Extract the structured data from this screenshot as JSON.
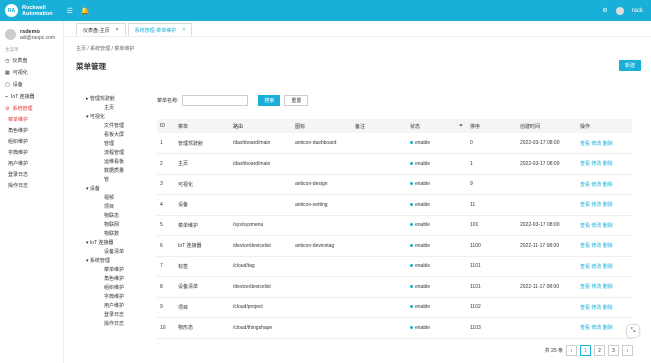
{
  "header": {
    "logo": "RA",
    "brand_line1": "Rockwell",
    "brand_line2": "Automation",
    "user": "rack"
  },
  "sidebar": {
    "name": "rsdemo",
    "email": "adi@raopc.com",
    "section": "主菜单",
    "items": [
      "仪表盘",
      "可视化",
      "设备",
      "IoT 连接器",
      "系统管理"
    ],
    "subitems": [
      "菜单维护",
      "角色维护",
      "组织维护",
      "字典维护",
      "用户维护",
      "登录日志",
      "操作日志"
    ]
  },
  "tabs": [
    "仪表盘-主页",
    "系统管理-菜单维护"
  ],
  "breadcrumb": "主页  /  系统管理  /  菜单维护",
  "title": "菜单管理",
  "new_label": "新建",
  "tree": [
    "管理驾驶舱",
    "主页",
    "可视化",
    "文件管理",
    "看板大屏",
    "管理",
    "流程管理",
    "运维看板",
    "数据质量",
    "管",
    "设备",
    "视频",
    "项目",
    "物联态",
    "物联网",
    "物联数",
    "IoT 连接器",
    "设备清单",
    "系统管理",
    "菜单维护",
    "角色维护",
    "组织维护",
    "字典维护",
    "用户维护",
    "登录日志",
    "操作日志"
  ],
  "search": {
    "label": "菜单名称:",
    "query": "搜索",
    "reset": "重置"
  },
  "columns": [
    "ID",
    "菜单",
    "路由",
    "图标",
    "备注",
    "状态",
    "排序",
    "创建时间",
    "操作"
  ],
  "rows": [
    [
      "1",
      "管理驾驶舱",
      "/dashboard/main",
      "anticon-dashboard",
      "",
      "enable",
      "0",
      "2022-03-17 08:00",
      "查看 修改 删除"
    ],
    [
      "2",
      "主页",
      "/dashboard/main",
      "",
      "",
      "enable",
      "1",
      "2022-03-17 08:00",
      "查看 修改 删除"
    ],
    [
      "3",
      "可视化",
      "",
      "anticon-design",
      "",
      "enable",
      "9",
      "",
      "查看 修改 删除"
    ],
    [
      "4",
      "设备",
      "",
      "anticon-setting",
      "",
      "enable",
      "11",
      "",
      "查看 修改 删除"
    ],
    [
      "5",
      "菜单维护",
      "/sys/sysmenu",
      "",
      "",
      "enable",
      "101",
      "2022-03-17 08:00",
      "查看 修改 删除"
    ],
    [
      "6",
      "IoT 连接器",
      "/device/devicelist",
      "anticon-devicetag",
      "",
      "enable",
      "1100",
      "2022-11-17 08:00",
      "查看 修改 删除"
    ],
    [
      "7",
      "标签",
      "/cloud/tag",
      "",
      "",
      "enable",
      "1101",
      "",
      "查看 修改 删除"
    ],
    [
      "8",
      "设备清单",
      "/device/devicelist",
      "",
      "",
      "enable",
      "1101",
      "2022-11-17 08:00",
      "查看 修改 删除"
    ],
    [
      "9",
      "项目",
      "/cloud/project",
      "",
      "",
      "enable",
      "1102",
      "",
      "查看 修改 删除"
    ],
    [
      "10",
      "物形态",
      "/cloud/thingshape",
      "",
      "",
      "enable",
      "1103",
      "",
      "查看 修改 删除"
    ]
  ],
  "pager": {
    "total": "共 25 条",
    "pages": [
      "1",
      "2",
      "3"
    ]
  }
}
